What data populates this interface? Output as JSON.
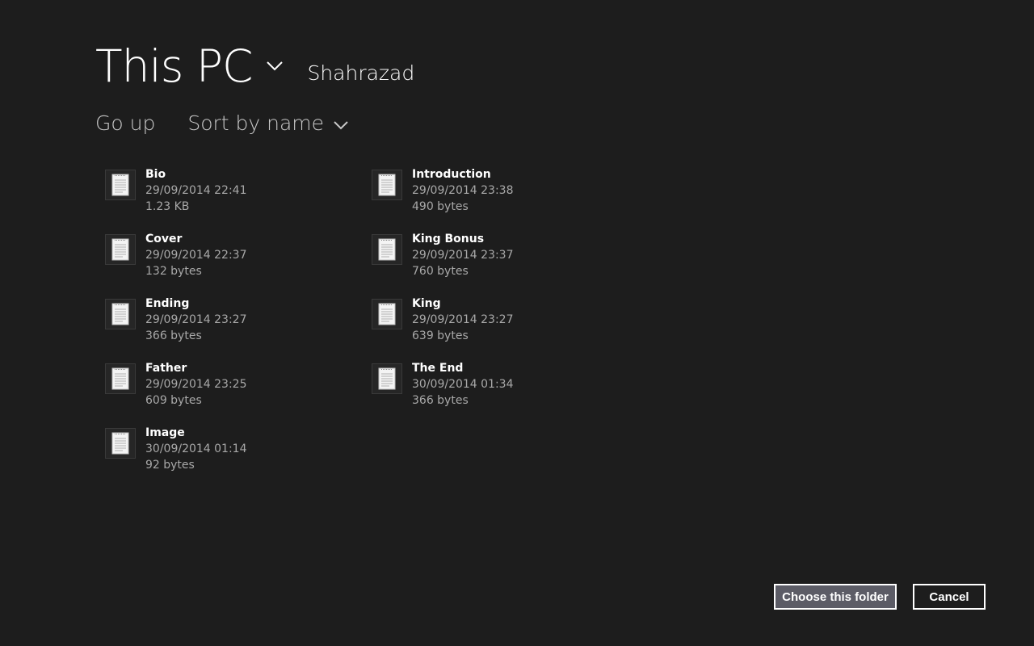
{
  "header": {
    "location": "This PC",
    "sublocation": "Shahrazad"
  },
  "commands": {
    "go_up": "Go up",
    "sort": "Sort by name"
  },
  "files": [
    {
      "name": "Bio",
      "date": "29/09/2014 22:41",
      "size": "1.23 KB"
    },
    {
      "name": "Cover",
      "date": "29/09/2014 22:37",
      "size": "132 bytes"
    },
    {
      "name": "Ending",
      "date": "29/09/2014 23:27",
      "size": "366 bytes"
    },
    {
      "name": "Father",
      "date": "29/09/2014 23:25",
      "size": "609 bytes"
    },
    {
      "name": "Image",
      "date": "30/09/2014 01:14",
      "size": "92 bytes"
    },
    {
      "name": "Introduction",
      "date": "29/09/2014 23:38",
      "size": "490 bytes"
    },
    {
      "name": "King Bonus",
      "date": "29/09/2014 23:37",
      "size": "760 bytes"
    },
    {
      "name": "King",
      "date": "29/09/2014 23:27",
      "size": "639 bytes"
    },
    {
      "name": "The End",
      "date": "30/09/2014 01:34",
      "size": "366 bytes"
    }
  ],
  "buttons": {
    "choose": "Choose this folder",
    "cancel": "Cancel"
  },
  "icons": {
    "location_dropdown": "chevron-down-icon",
    "sort_dropdown": "chevron-down-icon",
    "file": "text-document-icon"
  },
  "colors": {
    "background": "#1d1d1d",
    "primary_button": "#5c5c66",
    "secondary_text": "#a8a8a8"
  }
}
